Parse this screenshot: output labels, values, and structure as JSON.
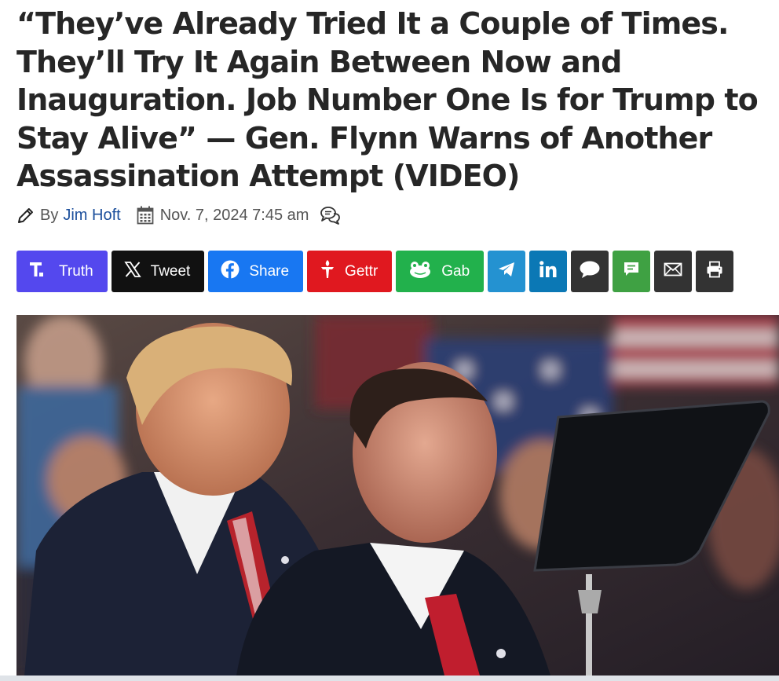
{
  "article": {
    "title": "“They’ve Already Tried It a Couple of Times. They’ll Try It Again Between Now and Inauguration. Job Number One Is for Trump to Stay Alive” — Gen. Flynn Warns of Another Assassination Attempt (VIDEO)",
    "by_label": "By",
    "author": "Jim Hoft",
    "date": "Nov. 7, 2024 7:45 am"
  },
  "share_buttons": [
    {
      "label": "Truth",
      "icon": "truth-social-icon",
      "color": "#5448ee"
    },
    {
      "label": "Tweet",
      "icon": "x-icon",
      "color": "#111111"
    },
    {
      "label": "Share",
      "icon": "facebook-icon",
      "color": "#1877f2"
    },
    {
      "label": "Gettr",
      "icon": "gettr-icon",
      "color": "#e0181f"
    },
    {
      "label": "Gab",
      "icon": "gab-frog-icon",
      "color": "#22b14c"
    },
    {
      "label": "",
      "icon": "telegram-icon",
      "color": "#2492d1"
    },
    {
      "label": "",
      "icon": "linkedin-icon",
      "color": "#0b78b5"
    },
    {
      "label": "",
      "icon": "comment-bubble-icon",
      "color": "#333333"
    },
    {
      "label": "",
      "icon": "sms-icon",
      "color": "#3fa143"
    },
    {
      "label": "",
      "icon": "email-icon",
      "color": "#333333"
    },
    {
      "label": "",
      "icon": "print-icon",
      "color": "#333333"
    }
  ],
  "meta_icons": {
    "author": "pencil-icon",
    "date": "calendar-icon",
    "comments": "comments-icon"
  },
  "colors": {
    "title": "#262626",
    "author_link": "#1c4f9c"
  },
  "hero_image": {
    "description_icon": "photo-image"
  }
}
